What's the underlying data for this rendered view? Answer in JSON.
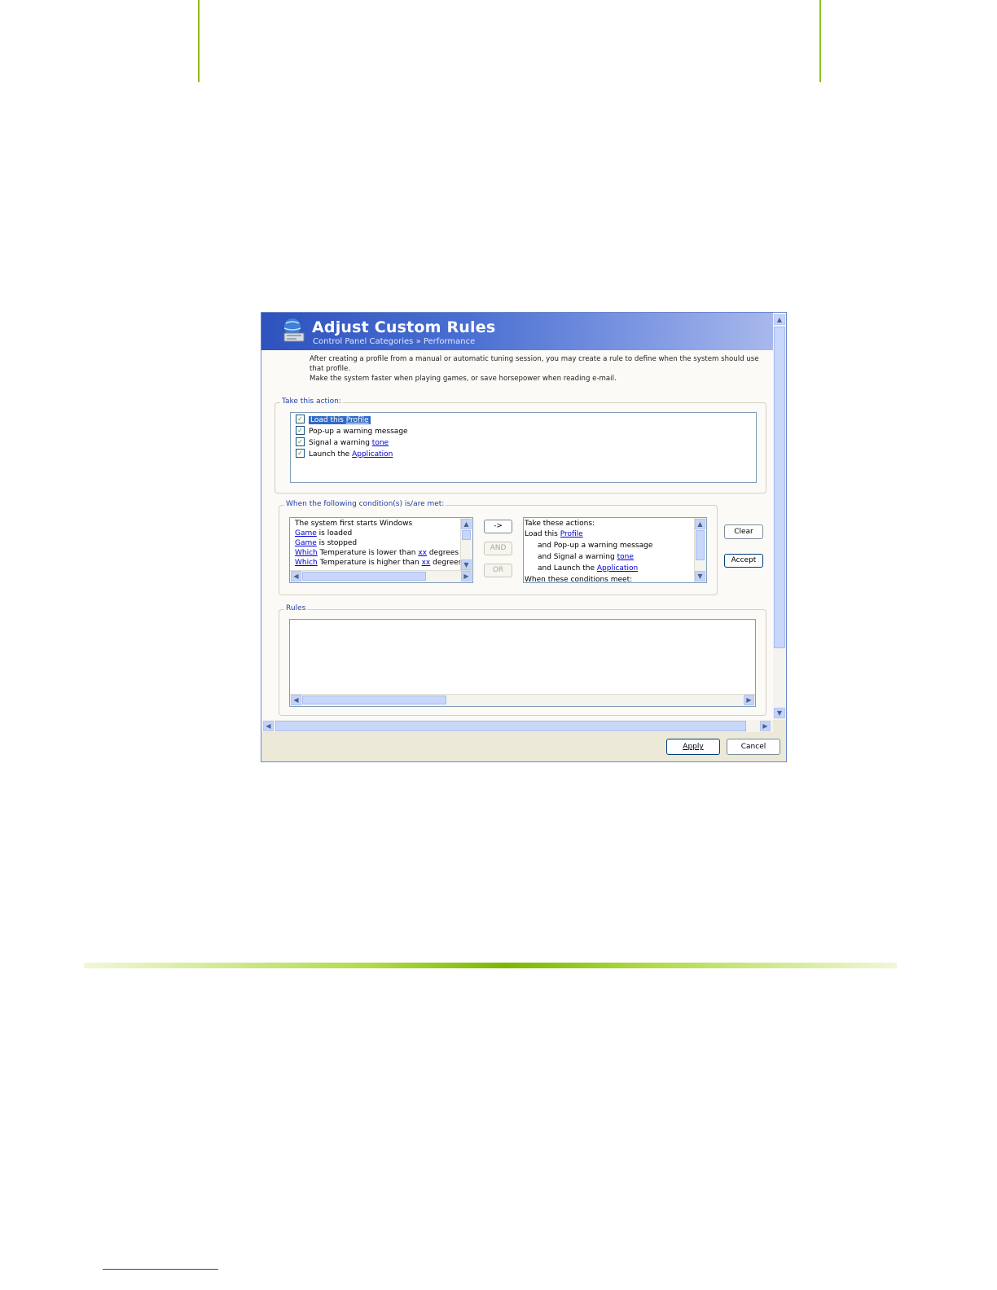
{
  "dialog": {
    "title": "Adjust Custom Rules",
    "breadcrumb": "Control Panel Categories  »  Performance",
    "description_line1": "After creating a profile from a manual or automatic tuning session, you may create a rule to define when the system should use that profile.",
    "description_line2": "Make the system faster when playing games, or save horsepower when reading e-mail."
  },
  "take_action": {
    "legend": "Take this action:",
    "items": [
      {
        "text": "Load this ",
        "link": "Profile",
        "checked": true,
        "selected": true
      },
      {
        "text": "Pop-up a warning message",
        "link": "",
        "checked": true
      },
      {
        "text": "Signal a warning ",
        "link": "tone",
        "checked": true
      },
      {
        "text": "Launch the ",
        "link": "Application",
        "checked": true
      }
    ]
  },
  "conditions": {
    "legend": "When the following condition(s) is/are met:",
    "items": [
      {
        "link": "",
        "pre": "",
        "text": "The system first starts Windows"
      },
      {
        "link": "Game",
        "text": " is loaded"
      },
      {
        "link": "Game",
        "text": " is stopped"
      },
      {
        "link": "Which",
        "text": " Temperature is lower than ",
        "link2": "xx",
        "text2": " degrees Cel"
      },
      {
        "link": "Which",
        "text": " Temperature is higher than ",
        "link2": "xx",
        "text2": " degrees Ce"
      }
    ]
  },
  "operators": {
    "arrow": "->",
    "and": "AND",
    "or": "OR"
  },
  "result": {
    "line1": "Take these actions:",
    "line2_text": "Load this ",
    "line2_link": "Profile",
    "line3": "and Pop-up a warning message",
    "line4_text": "and Signal a warning ",
    "line4_link": "tone",
    "line5_text": "and Launch the ",
    "line5_link": "Application",
    "line6": "When these conditions meet:"
  },
  "side_buttons": {
    "clear": "Clear",
    "accept": "Accept"
  },
  "rules": {
    "legend": "Rules"
  },
  "footer": {
    "apply": "Apply",
    "cancel": "Cancel"
  },
  "colors": {
    "accent_green": "#8cc21c",
    "banner_blue": "#2f53bd",
    "link_blue": "#0000cc"
  }
}
